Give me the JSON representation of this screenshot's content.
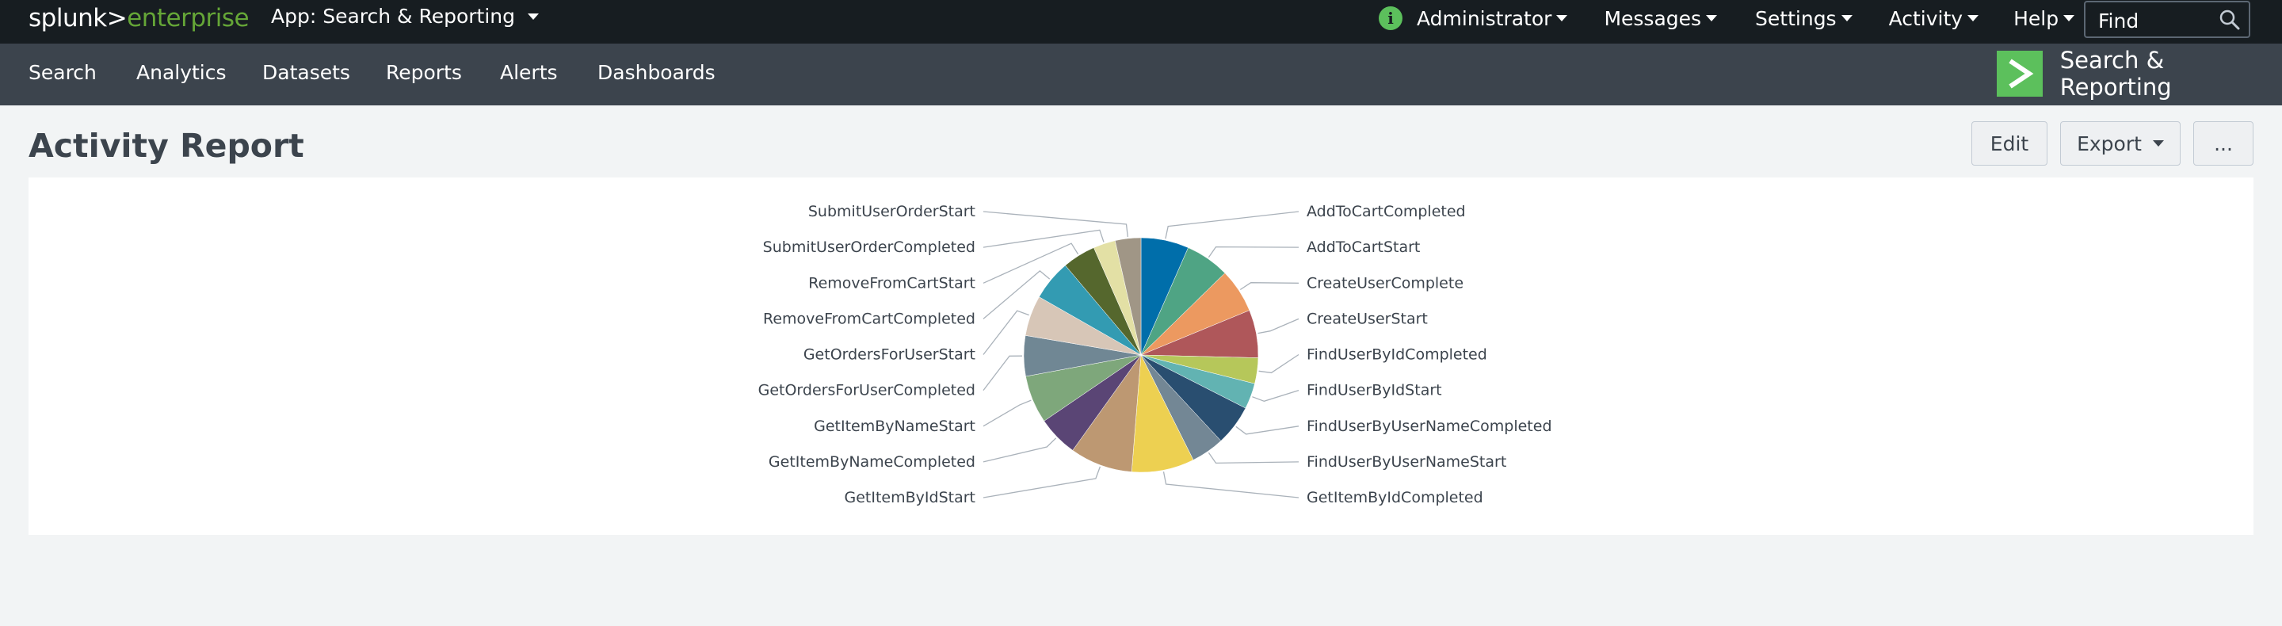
{
  "header": {
    "logo_part1": "splunk>",
    "logo_part2": "enterprise",
    "app_menu": "App: Search & Reporting",
    "menus": [
      "Administrator",
      "Messages",
      "Settings",
      "Activity",
      "Help"
    ],
    "find_placeholder": "Find"
  },
  "nav": {
    "items": [
      "Search",
      "Analytics",
      "Datasets",
      "Reports",
      "Alerts",
      "Dashboards"
    ],
    "app_title": "Search & Reporting"
  },
  "page": {
    "title": "Activity Report",
    "buttons": {
      "edit": "Edit",
      "export": "Export",
      "more": "..."
    }
  },
  "colors": {
    "logo_accent": "#65a637",
    "top_bar": "#171d21",
    "nav_bar": "#3c444d",
    "brand": "#5cc05c"
  },
  "chart_data": {
    "type": "pie",
    "categories": [
      "AddToCartCompleted",
      "AddToCartStart",
      "CreateUserComplete",
      "CreateUserStart",
      "FindUserByIdCompleted",
      "FindUserByIdStart",
      "FindUserByUserNameCompleted",
      "FindUserByUserNameStart",
      "GetItemByIdCompleted",
      "GetItemByIdStart",
      "GetItemByNameCompleted",
      "GetItemByNameStart",
      "GetOrdersForUserCompleted",
      "GetOrdersForUserStart",
      "RemoveFromCartCompleted",
      "RemoveFromCartStart",
      "SubmitUserOrderCompleted",
      "SubmitUserOrderStart"
    ],
    "values": [
      6.5,
      6.0,
      6.0,
      6.5,
      3.5,
      3.5,
      5.5,
      4.5,
      8.5,
      8.5,
      5.5,
      6.5,
      5.5,
      5.5,
      5.5,
      4.5,
      3.0,
      3.5
    ],
    "colors": [
      "#006eaa",
      "#4fa484",
      "#ec9960",
      "#af575a",
      "#b6c75a",
      "#62b3b2",
      "#294e70",
      "#738795",
      "#edd051",
      "#bd9872",
      "#5a4575",
      "#7ea77b",
      "#708794",
      "#d7c6b7",
      "#339bb2",
      "#55672d",
      "#e3e0a5",
      "#a09686"
    ]
  }
}
